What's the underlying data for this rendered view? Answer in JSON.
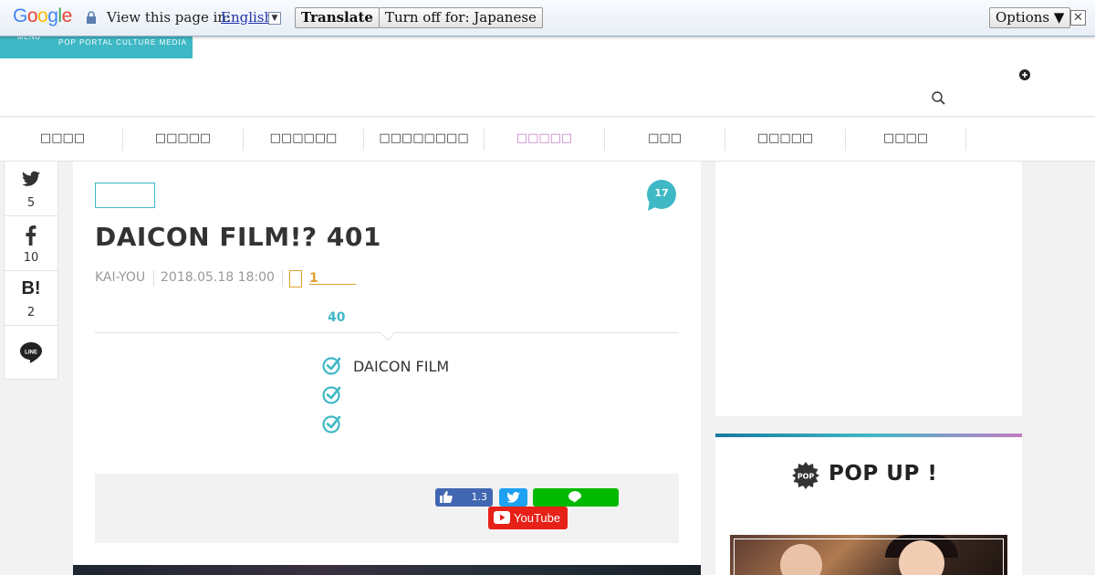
{
  "translate_bar": {
    "logo": "Google",
    "view_label": "View this page in:",
    "language": "English",
    "translate_button": "Translate",
    "turn_off_button": "Turn off for: Japanese",
    "options_button": "Options ▼",
    "close_label": "✕"
  },
  "header": {
    "menu_label": "MENU",
    "tagline": "POP PORTAL CULTURE MEDIA"
  },
  "nav": {
    "items": [
      "□□□□",
      "□□□□□",
      "□□□□□□",
      "□□□□□□□□",
      "□□□□□",
      "□□□",
      "□□□□□",
      "□□□□"
    ],
    "active_index": 4,
    "active_color": "#c27cc2"
  },
  "share": {
    "twitter_count": "5",
    "facebook_count": "10",
    "hatena_label": "B!",
    "hatena_count": "2"
  },
  "article": {
    "comment_count": "17",
    "title": "DAICON FILM!? 401",
    "author": "KAI-YOU",
    "date": "2018.05.18 18:00",
    "clip_count": "1",
    "summary_count": "40",
    "points": [
      "DAICON FILM",
      "",
      ""
    ],
    "fb_like_count": "1.3",
    "youtube_label": "YouTube"
  },
  "sidebar": {
    "popup_title": "POP UP !",
    "pop_icon_text": "POP"
  },
  "colors": {
    "teal": "#3fb8c5",
    "orange": "#e0a030",
    "facebook": "#4267b2",
    "twitter": "#1da1f2",
    "line": "#00b900",
    "youtube": "#e62117"
  }
}
